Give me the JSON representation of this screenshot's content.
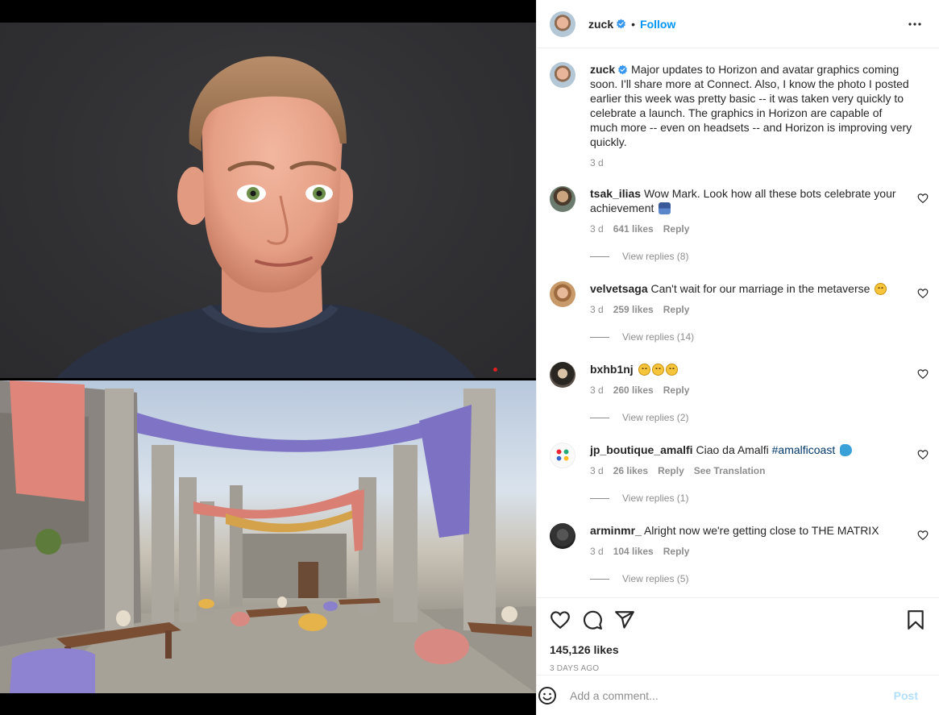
{
  "post": {
    "author": "zuck",
    "follow_label": "Follow",
    "separator": "•",
    "caption_author": "zuck",
    "caption": "Major updates to Horizon and avatar graphics coming soon. I'll share more at Connect. Also, I know the photo I posted earlier this week was pretty basic -- it was taken very quickly to celebrate a launch. The graphics in Horizon are capable of much more -- even on headsets -- and Horizon is improving very quickly.",
    "caption_time": "3 d",
    "likes": "145,126 likes",
    "date": "3 DAYS AGO"
  },
  "comments": [
    {
      "user": "tsak_ilias",
      "text": "Wow Mark. Look how all these bots celebrate your achievement",
      "emoji": "person-bowing",
      "time": "3 d",
      "likes": "641 likes",
      "reply": "Reply",
      "view_replies": "View replies (8)"
    },
    {
      "user": "velvetsaga",
      "text": "Can't wait for our marriage in the metaverse",
      "emoji": "pleading-face",
      "time": "3 d",
      "likes": "259 likes",
      "reply": "Reply",
      "view_replies": "View replies (14)"
    },
    {
      "user": "bxhb1nj",
      "text": "",
      "emoji": "frowning-face x3",
      "time": "3 d",
      "likes": "260 likes",
      "reply": "Reply",
      "view_replies": "View replies (2)"
    },
    {
      "user": "jp_boutique_amalfi",
      "text": "Ciao da Amalfi",
      "hashtag": "#amalficoast",
      "emoji": "fish",
      "time": "3 d",
      "likes": "26 likes",
      "reply": "Reply",
      "translate": "See Translation",
      "view_replies": "View replies (1)"
    },
    {
      "user": "arminmr_",
      "text": "Alright now we're getting close to THE MATRIX",
      "time": "3 d",
      "likes": "104 likes",
      "reply": "Reply",
      "view_replies": "View replies (5)"
    }
  ],
  "add_comment": {
    "placeholder": "Add a comment...",
    "post_label": "Post"
  },
  "colors": {
    "link_blue": "#0095f6",
    "verified_blue": "#3897f0",
    "muted": "#8e8e8e",
    "text": "#262626",
    "post_disabled": "#b2dffc",
    "hashtag": "#00376b"
  },
  "icons": [
    "verified-badge-icon",
    "more-options-icon",
    "heart-icon",
    "comment-icon",
    "share-icon",
    "bookmark-icon",
    "emoji-smiley-icon"
  ]
}
